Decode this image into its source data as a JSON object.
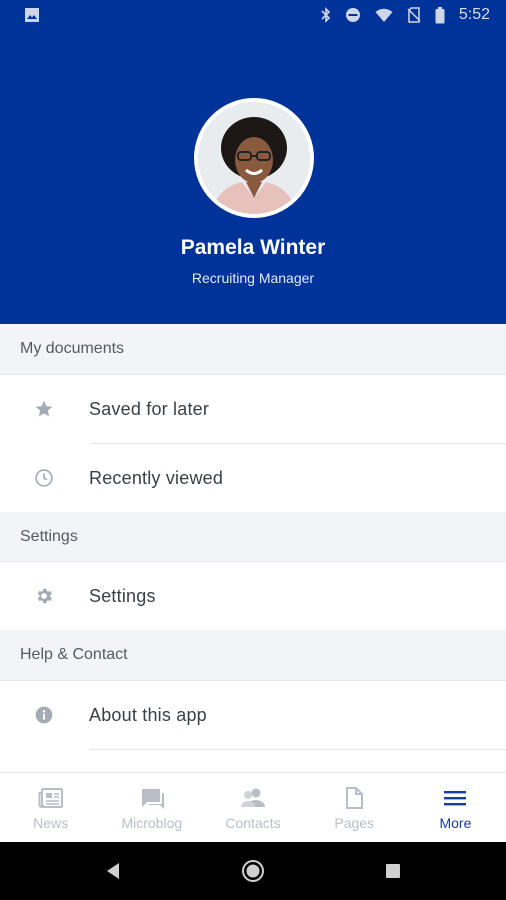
{
  "status_bar": {
    "time": "5:52",
    "icons": [
      "image-icon",
      "bluetooth-icon",
      "do-not-disturb-icon",
      "wifi-icon",
      "no-sim-icon",
      "battery-icon"
    ]
  },
  "profile": {
    "name": "Pamela Winter",
    "role": "Recruiting Manager"
  },
  "sections": [
    {
      "title": "My documents",
      "items": [
        {
          "label": "Saved for later",
          "icon": "star-icon"
        },
        {
          "label": "Recently viewed",
          "icon": "clock-icon"
        }
      ]
    },
    {
      "title": "Settings",
      "items": [
        {
          "label": "Settings",
          "icon": "gear-icon"
        }
      ]
    },
    {
      "title": "Help & Contact",
      "items": [
        {
          "label": "About this app",
          "icon": "info-icon"
        }
      ]
    }
  ],
  "tabs": [
    {
      "label": "News",
      "icon": "newspaper-icon",
      "active": false
    },
    {
      "label": "Microblog",
      "icon": "chat-icon",
      "active": false
    },
    {
      "label": "Contacts",
      "icon": "contacts-icon",
      "active": false
    },
    {
      "label": "Pages",
      "icon": "page-icon",
      "active": false
    },
    {
      "label": "More",
      "icon": "menu-icon",
      "active": true
    }
  ],
  "colors": {
    "header_bg": "#003399",
    "active_tab": "#1a3a9c",
    "inactive_tab": "#b9bec6",
    "section_bg": "#f2f4f7"
  }
}
